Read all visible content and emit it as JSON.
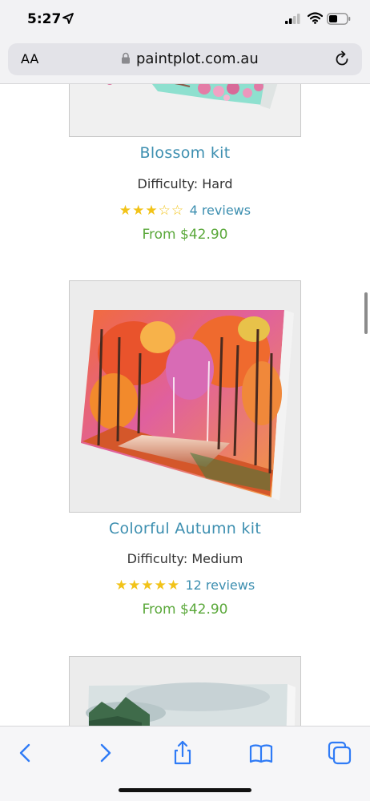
{
  "status_bar": {
    "time": "5:27"
  },
  "browser": {
    "text_size_label": "AA",
    "url": "paintplot.com.au"
  },
  "products": [
    {
      "title": "Blossom kit",
      "difficulty_label": "Difficulty:",
      "difficulty": "Hard",
      "rating": 3,
      "rating_max": 5,
      "reviews": "4 reviews",
      "price": "From $42.90"
    },
    {
      "title": "Colorful Autumn kit",
      "difficulty_label": "Difficulty:",
      "difficulty": "Medium",
      "rating": 5,
      "rating_max": 5,
      "reviews": "12 reviews",
      "price": "From $42.90"
    }
  ],
  "colors": {
    "link": "#3d8fb0",
    "price": "#5aa83a",
    "star": "#f2c318",
    "toolbar_icon": "#2f7bf6"
  },
  "icons": [
    "location-arrow-icon",
    "signal-icon",
    "wifi-icon",
    "battery-icon",
    "lock-icon",
    "reload-icon",
    "back-icon",
    "forward-icon",
    "share-icon",
    "bookmarks-icon",
    "tabs-icon"
  ]
}
